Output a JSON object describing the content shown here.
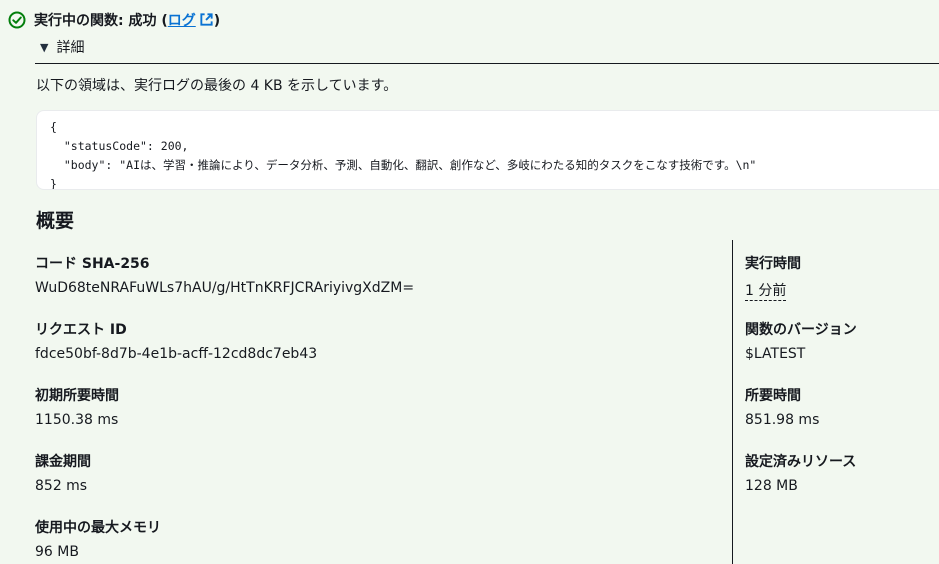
{
  "status": {
    "text_prefix": "実行中の関数: 成功 (",
    "log_link": "ログ",
    "text_suffix": ")",
    "color": "#037f0c"
  },
  "details": {
    "toggle_label": "詳細",
    "description": "以下の領域は、実行ログの最後の 4 KB を示しています。",
    "code": "{\n  \"statusCode\": 200,\n  \"body\": \"AIは、学習・推論により、データ分析、予測、自動化、翻訳、創作など、多岐にわたる知的タスクをこなす技術です。\\n\"\n}"
  },
  "summary": {
    "title": "概要",
    "left": [
      {
        "label": "コード SHA-256",
        "value": "WuD68teNRAFuWLs7hAU/g/HtTnKRFJCRAriyivgXdZM="
      },
      {
        "label": "リクエスト ID",
        "value": "fdce50bf-8d7b-4e1b-acff-12cd8dc7eb43"
      },
      {
        "label": "初期所要時間",
        "value": "1150.38 ms"
      },
      {
        "label": "課金期間",
        "value": "852 ms"
      },
      {
        "label": "使用中の最大メモリ",
        "value": "96 MB"
      }
    ],
    "right": [
      {
        "label": "実行時間",
        "value": "1 分前"
      },
      {
        "label": "関数のバージョン",
        "value": "$LATEST"
      },
      {
        "label": "所要時間",
        "value": "851.98 ms"
      },
      {
        "label": "設定済みリソース",
        "value": "128 MB"
      }
    ]
  }
}
